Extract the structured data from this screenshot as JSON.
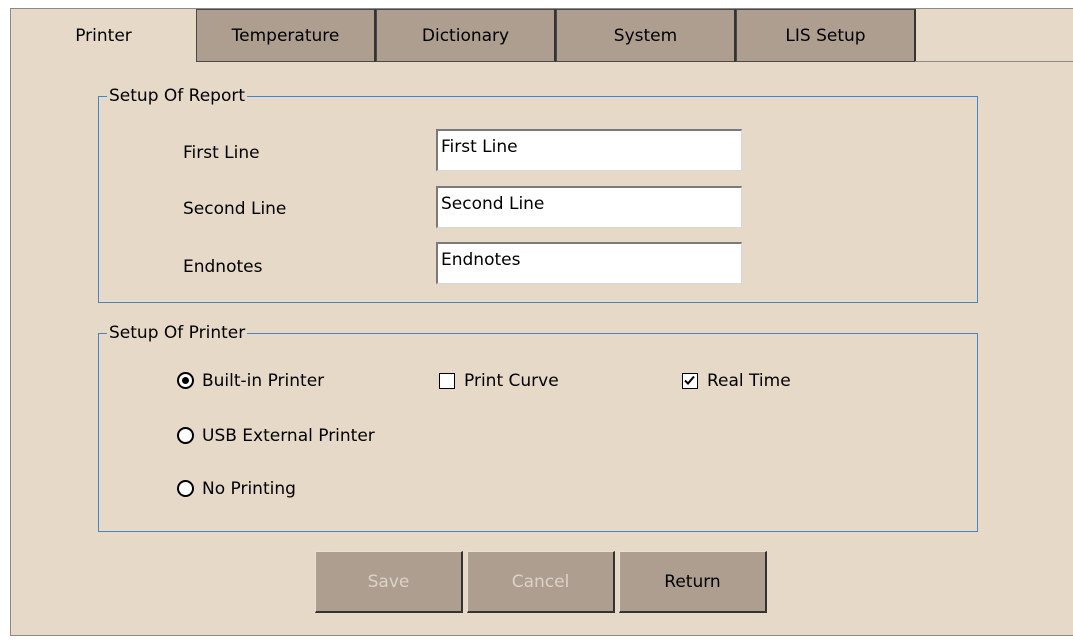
{
  "tabs": [
    {
      "label": "Printer",
      "active": true
    },
    {
      "label": "Temperature",
      "active": false
    },
    {
      "label": "Dictionary",
      "active": false
    },
    {
      "label": "System",
      "active": false
    },
    {
      "label": "LIS Setup",
      "active": false
    }
  ],
  "report": {
    "legend": "Setup Of Report",
    "first_line": {
      "label": "First Line",
      "value": "First Line"
    },
    "second_line": {
      "label": "Second Line",
      "value": "Second Line"
    },
    "endnotes": {
      "label": "Endnotes",
      "value": "Endnotes"
    }
  },
  "printer": {
    "legend": "Setup Of Printer",
    "builtin": {
      "label": "Built-in Printer",
      "selected": true
    },
    "usb": {
      "label": "USB External Printer",
      "selected": false
    },
    "none": {
      "label": "No Printing",
      "selected": false
    },
    "print_curve": {
      "label": "Print Curve",
      "checked": false
    },
    "real_time": {
      "label": "Real Time",
      "checked": true
    }
  },
  "buttons": {
    "save": {
      "label": "Save",
      "enabled": false
    },
    "cancel": {
      "label": "Cancel",
      "enabled": false
    },
    "return": {
      "label": "Return",
      "enabled": true
    }
  }
}
